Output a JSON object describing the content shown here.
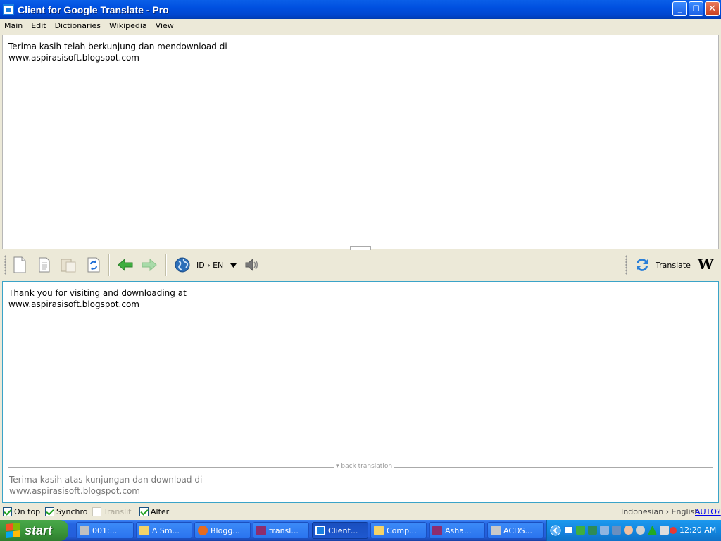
{
  "window": {
    "title": "Client for Google Translate - Pro",
    "min": "_",
    "max": "❐",
    "close": "✕"
  },
  "menu": [
    "Main",
    "Edit",
    "Dictionaries",
    "Wikipedia",
    "View"
  ],
  "source": {
    "text": "Terima kasih telah berkunjung dan mendownload di\nwww.aspirasisoft.blogspot.com"
  },
  "toolbar": {
    "lang_pair": "ID › EN",
    "translate_label": "Translate",
    "wiki_label": "W"
  },
  "result": {
    "text": "Thank you for visiting and downloading at\nwww.aspirasisoft.blogspot.com"
  },
  "back_translation": {
    "label": "back translation",
    "text": "Terima kasih atas kunjungan dan download di\nwww.aspirasisoft.blogspot.com"
  },
  "status": {
    "checkboxes": [
      {
        "label": "On top",
        "checked": true,
        "enabled": true
      },
      {
        "label": "Synchro",
        "checked": true,
        "enabled": true
      },
      {
        "label": "Translit",
        "checked": false,
        "enabled": false
      },
      {
        "label": "Alter",
        "checked": true,
        "enabled": true
      }
    ],
    "languages": "Indonesian › English",
    "auto": "AUTO?"
  },
  "taskbar": {
    "start": "start",
    "tasks": [
      {
        "label": "001:...",
        "icon": "pc-icon",
        "color": "#c0c0c0"
      },
      {
        "label": "∆ Sm...",
        "icon": "folder-icon",
        "color": "#f3d36a"
      },
      {
        "label": "Blogg...",
        "icon": "firefox-icon",
        "color": "#e66b1f"
      },
      {
        "label": "transl...",
        "icon": "winrar-icon",
        "color": "#8e2d6e"
      },
      {
        "label": "Client...",
        "icon": "app-icon",
        "color": "#1a7fe0"
      },
      {
        "label": "Comp...",
        "icon": "folder-icon",
        "color": "#f3d36a"
      },
      {
        "label": "Asha...",
        "icon": "winrar-icon",
        "color": "#8e2d6e"
      },
      {
        "label": "ACDS...",
        "icon": "acdsee-icon",
        "color": "#c9c9c9"
      }
    ],
    "clock": "12:20 AM"
  },
  "colors": {
    "title_bar": "#0050e0",
    "taskbar": "#245edb",
    "start_button": "#3c983c"
  }
}
